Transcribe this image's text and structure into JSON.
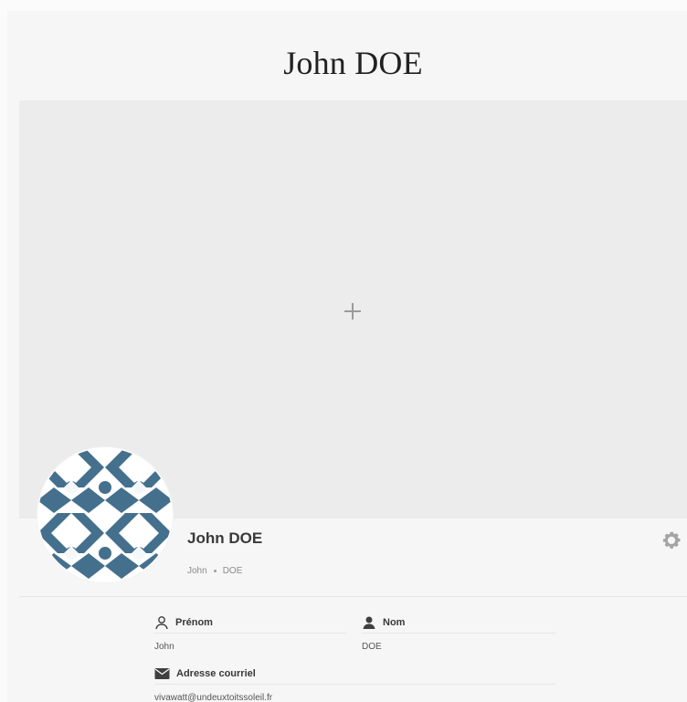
{
  "page": {
    "title": "John DOE",
    "background": "#f6f6f6"
  },
  "cover": {
    "add_icon": "plus-icon",
    "background": "#ececec"
  },
  "profile": {
    "name": "John DOE",
    "first_name": "John",
    "last_name": "DOE",
    "settings_icon": "gear-icon",
    "avatar_icon": "geometric-pattern-avatar-icon",
    "avatar_color": "#44708d"
  },
  "fields": {
    "prenom": {
      "label": "Prénom",
      "value": "John",
      "icon": "user-outline-icon"
    },
    "nom": {
      "label": "Nom",
      "value": "DOE",
      "icon": "user-solid-icon"
    },
    "email": {
      "label": "Adresse courriel",
      "value": "vivawatt@undeuxtoitssoleil.fr",
      "icon": "envelope-icon"
    }
  }
}
